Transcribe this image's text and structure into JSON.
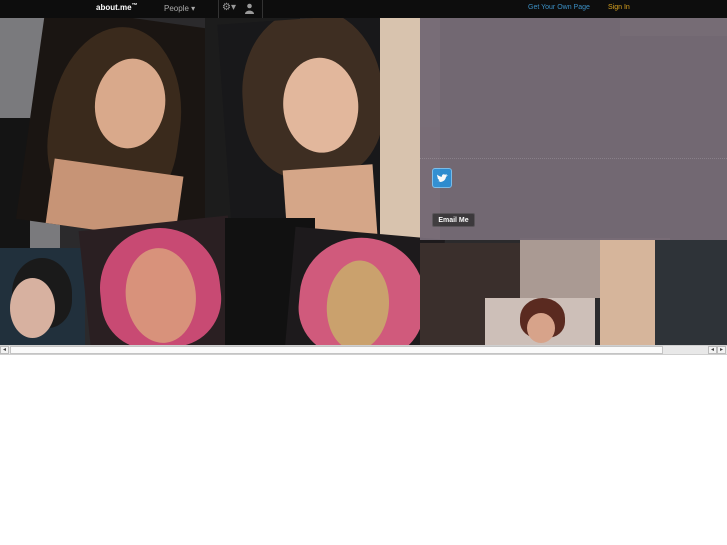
{
  "topbar": {
    "brand": "about.me",
    "brand_tm": "™",
    "people_label": "People ▾",
    "get_page_label": "Get Your Own Page",
    "sign_in_label": "Sign In"
  },
  "profile": {
    "email_button_label": "Email Me"
  },
  "colors": {
    "topbar_bg": "#0d0d0d",
    "panel_bg": "#756a75",
    "link_blue": "#3b8fc4",
    "sign_in": "#d9a21f",
    "twitter_blue": "#2f8fd4"
  },
  "icons": [
    "settings-gear-icon",
    "user-icon",
    "twitter-icon"
  ]
}
